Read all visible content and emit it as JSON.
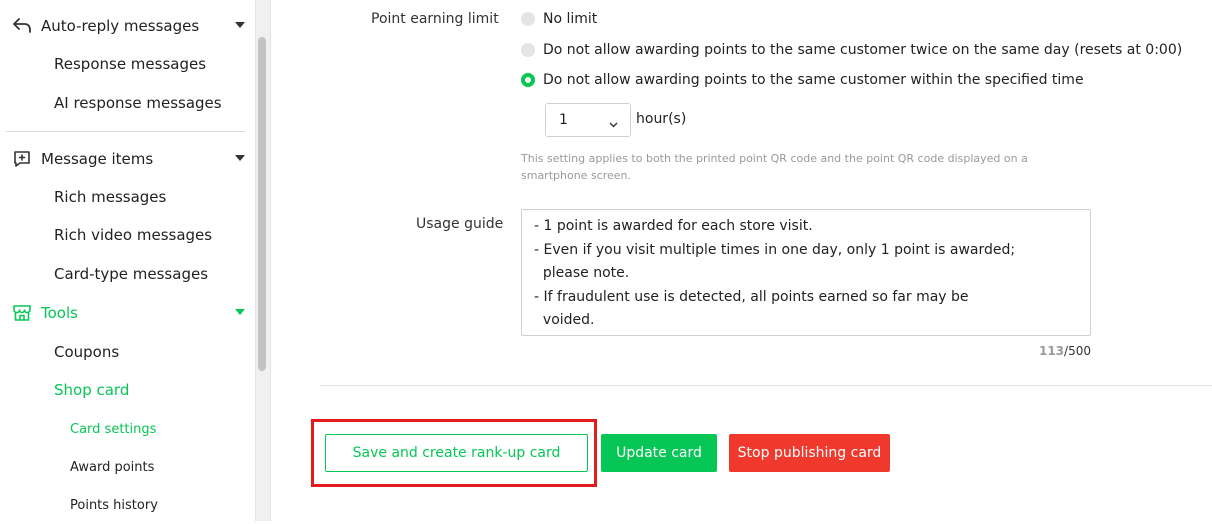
{
  "sidebar": {
    "auto_reply": {
      "label": "Auto-reply messages",
      "icon": "reply-arrow-icon"
    },
    "auto_reply_children": [
      {
        "label": "Response messages"
      },
      {
        "label": "AI response messages"
      }
    ],
    "message_items": {
      "label": "Message items",
      "icon": "add-message-icon"
    },
    "message_items_children": [
      {
        "label": "Rich messages"
      },
      {
        "label": "Rich video messages"
      },
      {
        "label": "Card-type messages"
      }
    ],
    "tools": {
      "label": "Tools",
      "icon": "shop-icon",
      "color": "#06c755"
    },
    "tools_children": [
      {
        "label": "Coupons"
      },
      {
        "label": "Shop card"
      }
    ],
    "shopcard_children": [
      {
        "label": "Card settings"
      },
      {
        "label": "Award points"
      },
      {
        "label": "Points history"
      }
    ]
  },
  "form": {
    "point_limit": {
      "label": "Point earning limit",
      "options": [
        {
          "label": "No limit",
          "checked": false
        },
        {
          "label": "Do not allow awarding points to the same customer twice on the same day (resets at 0:00)",
          "checked": false
        },
        {
          "label": "Do not allow awarding points to the same customer within the specified time",
          "checked": true
        }
      ],
      "select_value": "1",
      "unit": "hour(s)",
      "note": "This setting applies to both the printed point QR code and the point QR code displayed on a smartphone screen."
    },
    "guide": {
      "label": "Usage guide",
      "lines": [
        "- 1 point is awarded for each store visit.",
        "- Even if you visit multiple times in one day, only 1 point is awarded;",
        "  please note.",
        "- If fraudulent use is detected, all points earned so far may be",
        "  voided."
      ],
      "count": "113",
      "max": "/500"
    }
  },
  "buttons": {
    "save_rankup": "Save and create rank-up card",
    "update": "Update card",
    "unpublish": "Stop publishing card"
  },
  "colors": {
    "accent": "#06c755",
    "danger": "#f0392c",
    "highlight": "#e41b1b"
  }
}
